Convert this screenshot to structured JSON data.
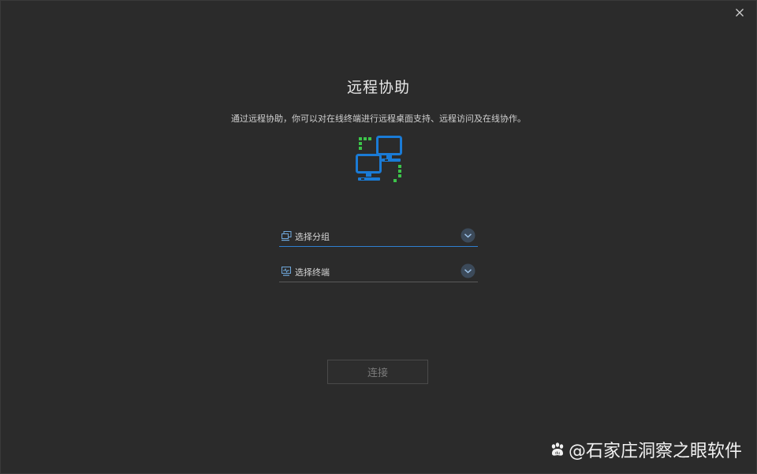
{
  "dialog": {
    "title": "远程协助",
    "description": "通过远程协助，你可以对在线终端进行远程桌面支持、远程访问及在线协作。",
    "close_icon": "close-icon"
  },
  "illustration": {
    "icon": "remote-computers-icon",
    "colors": {
      "monitor": "#1a7bd6",
      "dashes": "#3cc44a"
    }
  },
  "fields": {
    "group": {
      "label": "选择分组",
      "icon": "group-computer-icon",
      "active": true
    },
    "terminal": {
      "label": "选择终端",
      "icon": "terminal-monitor-icon",
      "active": false
    }
  },
  "connect_button": {
    "label": "连接",
    "enabled": false
  },
  "watermark": {
    "text": "@石家庄洞察之眼软件",
    "icon": "paw-logo-icon"
  },
  "colors": {
    "accent": "#2f7fd0",
    "background": "#2b2b2b"
  }
}
